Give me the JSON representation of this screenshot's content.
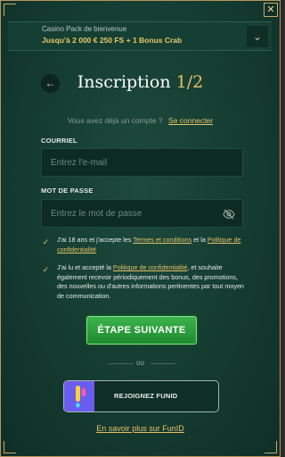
{
  "modal": {
    "close_glyph": "✕",
    "bonus": {
      "subtitle": "Casino Pack de bienvenue",
      "main": "Jusqu'à 2 000 € 250 FS + 1 Bonus Crab",
      "toggle_glyph": "⌄"
    },
    "back_glyph": "←",
    "title_main": "Inscription",
    "title_step": "1/2",
    "login_prompt": "Vous avez déjà un compte ?",
    "login_link": "Se connecter",
    "email": {
      "label": "COURRIEL",
      "placeholder": "Entrez l'e-mail"
    },
    "password": {
      "label": "MOT DE PASSE",
      "placeholder": "Entrez le mot de passe"
    },
    "consent1": {
      "check_glyph": "✓",
      "text_before": "J'ai 18 ans et j'accepte les",
      "link1": "Termes et conditions",
      "text_mid": "et la",
      "link2": "Politique de confidentialité"
    },
    "consent2": {
      "check_glyph": "✓",
      "text_before": "J'ai lu et accepté la",
      "link": "Politique de confidentialité",
      "text_after": ", et souhaite également recevoir périodiquement des bonus, des promotions, des nouvelles ou d'autres informations pertinentes par tout moyen de communication."
    },
    "next_button": "ÉTAPE SUIVANTE",
    "or_text": "ou",
    "funid_button": "REJOIGNEZ FUNID",
    "funid_more": "En savoir plus sur FunID"
  },
  "colors": {
    "accent_gold": "#e6c06a",
    "bg_green": "#143a2f",
    "button_green": "#2ea23e",
    "funid_purple": "#6b5cf0"
  }
}
